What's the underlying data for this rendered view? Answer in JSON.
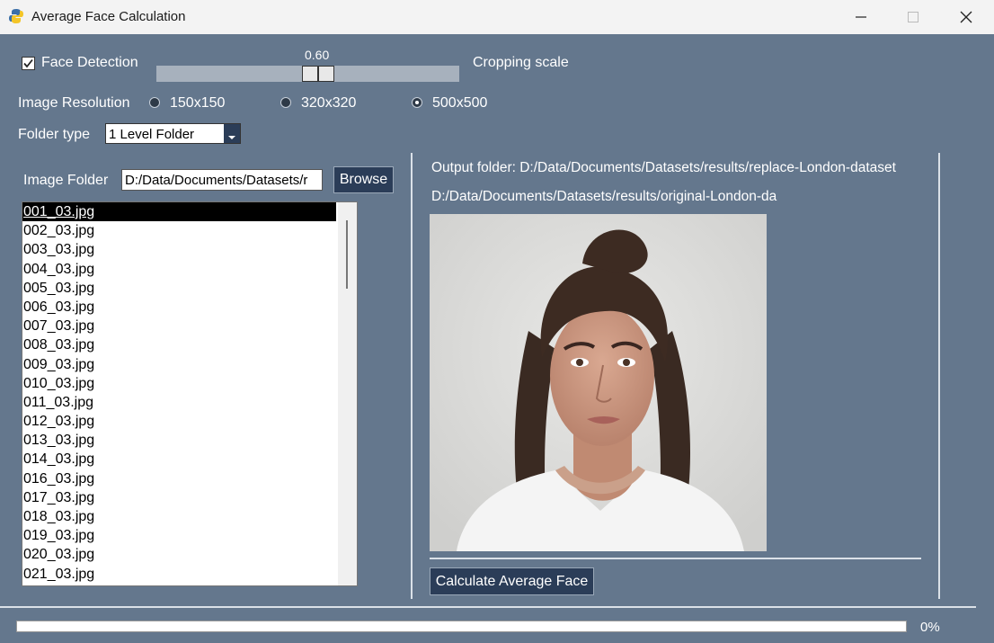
{
  "window": {
    "title": "Average Face Calculation",
    "controls": [
      "minimize-icon",
      "maximize-icon",
      "close-icon"
    ]
  },
  "face_detection": {
    "label": "Face Detection",
    "checked": true
  },
  "cropping": {
    "value_text": "0.60",
    "label": "Cropping scale"
  },
  "resolution": {
    "label": "Image Resolution",
    "options": [
      "150x150",
      "320x320",
      "500x500"
    ],
    "selected": "500x500"
  },
  "folder_type": {
    "label": "Folder type",
    "value": "1 Level Folder"
  },
  "image_folder": {
    "label": "Image Folder",
    "value": "D:/Data/Documents/Datasets/r",
    "browse_label": "Browse"
  },
  "file_list": {
    "selected": "001_03.jpg",
    "items": [
      "001_03.jpg",
      "002_03.jpg",
      "003_03.jpg",
      "004_03.jpg",
      "005_03.jpg",
      "006_03.jpg",
      "007_03.jpg",
      "008_03.jpg",
      "009_03.jpg",
      "010_03.jpg",
      "011_03.jpg",
      "012_03.jpg",
      "013_03.jpg",
      "014_03.jpg",
      "016_03.jpg",
      "017_03.jpg",
      "018_03.jpg",
      "019_03.jpg",
      "020_03.jpg",
      "021_03.jpg"
    ]
  },
  "output": {
    "folder_text": "Output folder: D:/Data/Documents/Datasets/results/replace-London-dataset",
    "path_text": "D:/Data/Documents/Datasets/results/original-London-da"
  },
  "calculate_label": "Calculate Average Face",
  "progress": {
    "value": 0,
    "text": "0%"
  },
  "colors": {
    "background": "#64778d",
    "button": "#2b3d58",
    "titlebar": "#f3f3f3"
  }
}
